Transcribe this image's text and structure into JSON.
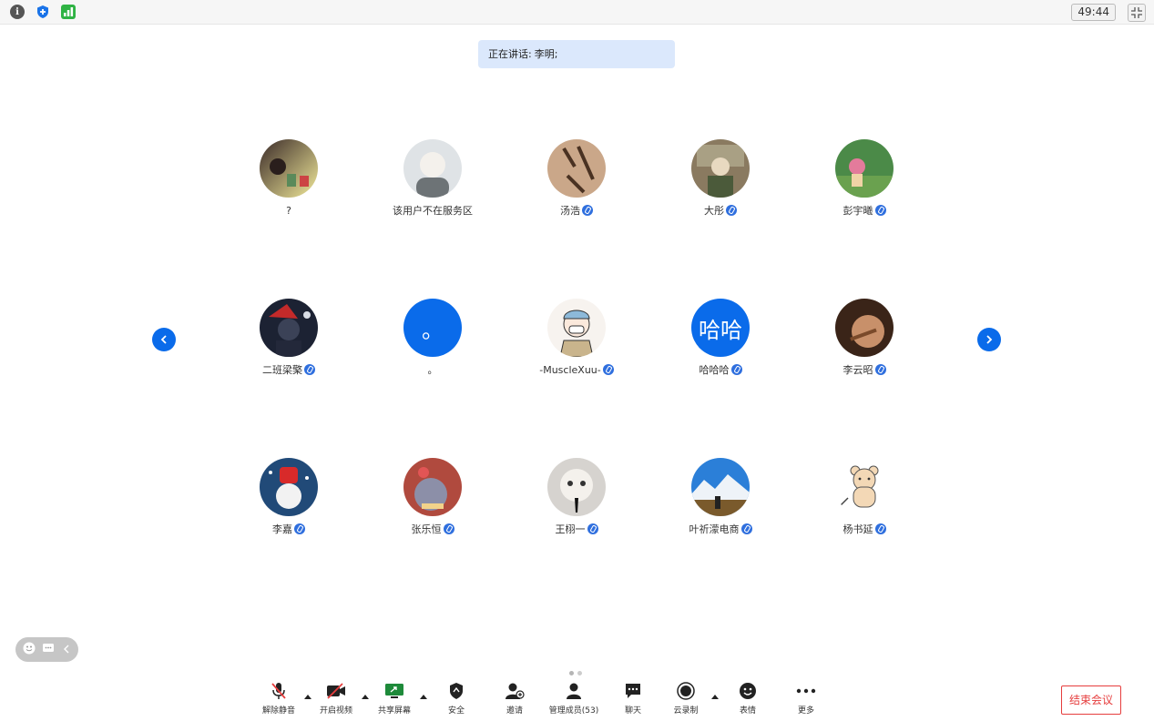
{
  "topbar": {
    "info_icon": "info-icon",
    "info_glyph": "i",
    "shield_icon": "shield-icon",
    "signal_icon": "signal-icon",
    "timer": "49:44",
    "shrink_icon": "exit-fullscreen-icon"
  },
  "speaking": {
    "label": "正在讲话:",
    "name": "李明;"
  },
  "participants": [
    {
      "name": "?",
      "muted": false,
      "avatar": "photo"
    },
    {
      "name": "该用户不在服务区",
      "muted": false,
      "avatar": "photo"
    },
    {
      "name": "汤浩",
      "muted": true,
      "avatar": "photo"
    },
    {
      "name": "大彤",
      "muted": true,
      "avatar": "photo"
    },
    {
      "name": "彭宇曦",
      "muted": true,
      "avatar": "photo"
    },
    {
      "name": "二班梁檠",
      "muted": true,
      "avatar": "photo"
    },
    {
      "name": "。",
      "muted": false,
      "avatar": "letter",
      "letter": "。"
    },
    {
      "name": "-MuscleXuu-",
      "muted": true,
      "avatar": "photo"
    },
    {
      "name": "哈哈哈",
      "muted": true,
      "avatar": "letter",
      "letter": "哈哈"
    },
    {
      "name": "李云昭",
      "muted": true,
      "avatar": "photo"
    },
    {
      "name": "李嘉",
      "muted": true,
      "avatar": "photo"
    },
    {
      "name": "张乐恒",
      "muted": true,
      "avatar": "photo"
    },
    {
      "name": "王栩一",
      "muted": true,
      "avatar": "photo"
    },
    {
      "name": "叶祈濛电商",
      "muted": true,
      "avatar": "photo"
    },
    {
      "name": "杨书延",
      "muted": true,
      "avatar": "photo"
    }
  ],
  "colors": {
    "accent": "#0a6bea",
    "speaker_bg": "#dbe8fc",
    "end_red": "#e63d3d",
    "mic_badge": "#2f6fde"
  },
  "toolbar": {
    "unmute": "解除静音",
    "start_video": "开启视频",
    "share_screen": "共享屏幕",
    "security": "安全",
    "invite": "邀请",
    "manage_members": "管理成员(53)",
    "chat": "聊天",
    "cloud_record": "云录制",
    "reactions": "表情",
    "more": "更多"
  },
  "end_meeting": "结束会议"
}
